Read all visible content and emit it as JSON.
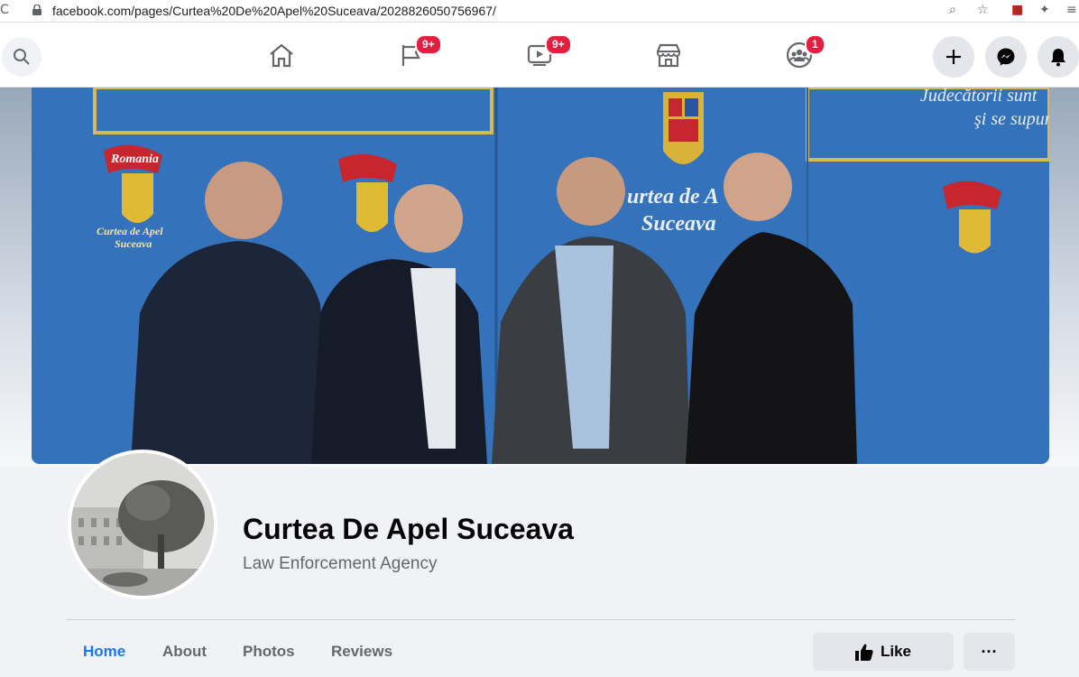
{
  "browser": {
    "url": "facebook.com/pages/Curtea%20De%20Apel%20Suceava/202882605075696 7/",
    "url_text": "facebook.com/pages/Curtea%20De%20Apel%20Suceava/2028826050756967/"
  },
  "fb_nav": {
    "pages_badge": "9+",
    "watch_badge": "9+",
    "groups_badge": "1"
  },
  "cover": {
    "top_text": "Judecătorii sunt",
    "top_text2": "şi se supun",
    "seal_text1": "Curtea de Apel",
    "seal_text2": "Suceava",
    "banner_text": "Romania",
    "sign1": "urtea de A",
    "sign2": "Suceava"
  },
  "page": {
    "name": "Curtea De Apel Suceava",
    "category": "Law Enforcement Agency"
  },
  "tabs": [
    {
      "label": "Home"
    },
    {
      "label": "About"
    },
    {
      "label": "Photos"
    },
    {
      "label": "Reviews"
    }
  ],
  "actions": {
    "like_label": "Like",
    "more_label": "···"
  },
  "colors": {
    "accent": "#1877f2",
    "badge": "#e41e3f"
  }
}
